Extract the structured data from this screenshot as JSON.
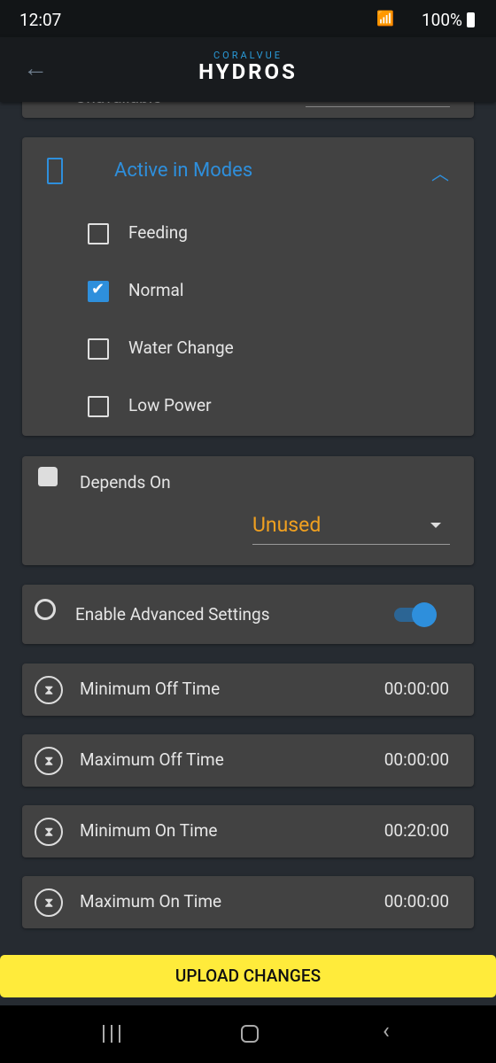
{
  "status_bar": {
    "time": "12:07",
    "battery": "100%"
  },
  "header": {
    "brand_top": "CORALVUE",
    "brand_main": "HYDROS",
    "tm": "™"
  },
  "partial_card": {
    "label": "Unavailable"
  },
  "modes": {
    "title": "Active in Modes",
    "items": [
      {
        "label": "Feeding",
        "checked": false
      },
      {
        "label": "Normal",
        "checked": true
      },
      {
        "label": "Water Change",
        "checked": false
      },
      {
        "label": "Low Power",
        "checked": false
      }
    ]
  },
  "depends": {
    "label": "Depends On",
    "value": "Unused"
  },
  "advanced": {
    "label": "Enable Advanced Settings",
    "enabled": true
  },
  "times": [
    {
      "label": "Minimum Off Time",
      "value": "00:00:00"
    },
    {
      "label": "Maximum Off Time",
      "value": "00:00:00"
    },
    {
      "label": "Minimum On Time",
      "value": "00:20:00"
    },
    {
      "label": "Maximum On Time",
      "value": "00:00:00"
    }
  ],
  "upload_label": "UPLOAD CHANGES",
  "colors": {
    "accent": "#2e8fdc",
    "value": "#f0a020",
    "button": "#ffeb3b"
  }
}
